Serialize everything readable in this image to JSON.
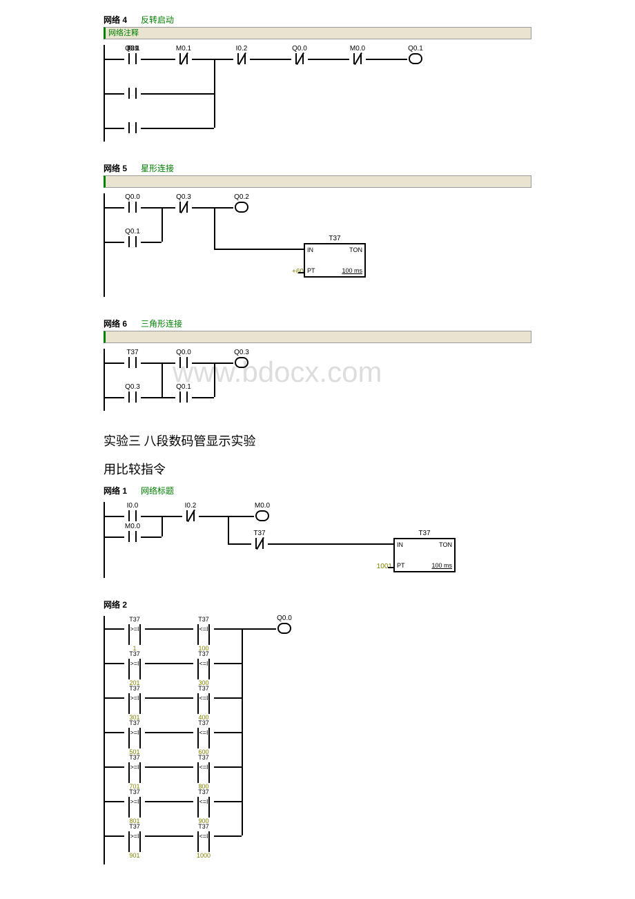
{
  "watermark": "www.bdocx.com",
  "section_heading_1": "实验三 八段数码管显示实验",
  "section_heading_2": "用比较指令",
  "networks": {
    "n4": {
      "num": "网络 4",
      "title": "反转启动",
      "comment": "网络注释",
      "contacts": {
        "c1": "I0.1",
        "c2": "M0.1",
        "c3": "I0.2",
        "c4": "Q0.0",
        "c5": "M0.0",
        "coil": "Q0.1",
        "b1": "T39",
        "b2": "Q0.1"
      }
    },
    "n5": {
      "num": "网络 5",
      "title": "星形连接",
      "contacts": {
        "c1": "Q0.0",
        "c2": "Q0.3",
        "coil": "Q0.2",
        "b1": "Q0.1"
      },
      "timer": {
        "name": "T37",
        "in": "IN",
        "type": "TON",
        "pt": "PT",
        "pt_val": "+60",
        "time": "100 ms"
      }
    },
    "n6": {
      "num": "网络 6",
      "title": "三角形连接",
      "contacts": {
        "c1": "T37",
        "c2": "Q0.0",
        "coil": "Q0.3",
        "b1": "Q0.3",
        "b2": "Q0.1"
      }
    },
    "n1": {
      "num": "网络 1",
      "title": "网络标题",
      "contacts": {
        "c1": "I0.0",
        "c2": "I0.2",
        "coil": "M0.0",
        "b1": "M0.0",
        "c3": "T37"
      },
      "timer": {
        "name": "T37",
        "in": "IN",
        "type": "TON",
        "pt": "PT",
        "pt_val": "1001",
        "time": "100 ms"
      }
    },
    "n2": {
      "num": "网络 2",
      "coil": "Q0.0",
      "rows": [
        {
          "l_top": "T37",
          "l_op": ">=I",
          "l_bot": "1",
          "r_top": "T37",
          "r_op": "<=I",
          "r_bot": "100"
        },
        {
          "l_top": "T37",
          "l_op": ">=I",
          "l_bot": "201",
          "r_top": "T37",
          "r_op": "<=I",
          "r_bot": "300"
        },
        {
          "l_top": "T37",
          "l_op": ">=I",
          "l_bot": "301",
          "r_top": "T37",
          "r_op": "<=I",
          "r_bot": "400"
        },
        {
          "l_top": "T37",
          "l_op": ">=I",
          "l_bot": "501",
          "r_top": "T37",
          "r_op": "<=I",
          "r_bot": "600"
        },
        {
          "l_top": "T37",
          "l_op": ">=I",
          "l_bot": "701",
          "r_top": "T37",
          "r_op": "<=I",
          "r_bot": "800"
        },
        {
          "l_top": "T37",
          "l_op": ">=I",
          "l_bot": "801",
          "r_top": "T37",
          "r_op": "<=I",
          "r_bot": "900"
        },
        {
          "l_top": "T37",
          "l_op": ">=I",
          "l_bot": "901",
          "r_top": "T37",
          "r_op": "<=I",
          "r_bot": "1000"
        }
      ]
    }
  }
}
